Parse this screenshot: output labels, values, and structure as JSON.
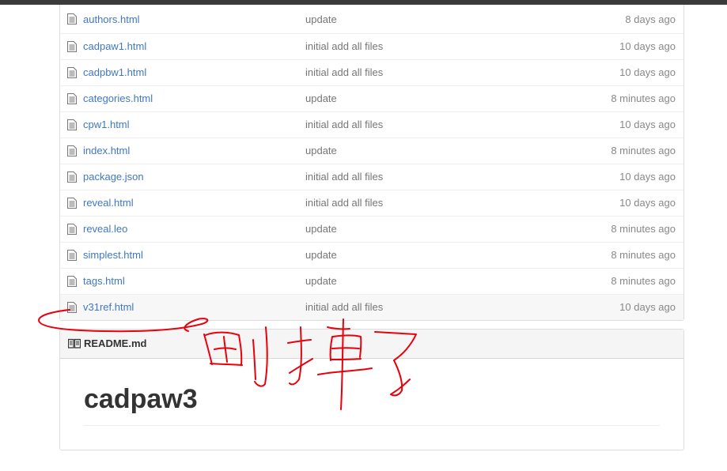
{
  "files": [
    {
      "name": "authors.html",
      "message": "update",
      "age": "8 days ago"
    },
    {
      "name": "cadpaw1.html",
      "message": "initial add all files",
      "age": "10 days ago"
    },
    {
      "name": "cadpbw1.html",
      "message": "initial add all files",
      "age": "10 days ago"
    },
    {
      "name": "categories.html",
      "message": "update",
      "age": "8 minutes ago"
    },
    {
      "name": "cpw1.html",
      "message": "initial add all files",
      "age": "10 days ago"
    },
    {
      "name": "index.html",
      "message": "update",
      "age": "8 minutes ago"
    },
    {
      "name": "package.json",
      "message": "initial add all files",
      "age": "10 days ago"
    },
    {
      "name": "reveal.html",
      "message": "initial add all files",
      "age": "10 days ago"
    },
    {
      "name": "reveal.leo",
      "message": "update",
      "age": "8 minutes ago"
    },
    {
      "name": "simplest.html",
      "message": "update",
      "age": "8 minutes ago"
    },
    {
      "name": "tags.html",
      "message": "update",
      "age": "8 minutes ago"
    },
    {
      "name": "v31ref.html",
      "message": "initial add all files",
      "age": "10 days ago"
    }
  ],
  "readme": {
    "title": "README.md",
    "heading": "cadpaw3"
  },
  "colors": {
    "link": "#4078c0",
    "annotation": "#e8000b"
  }
}
